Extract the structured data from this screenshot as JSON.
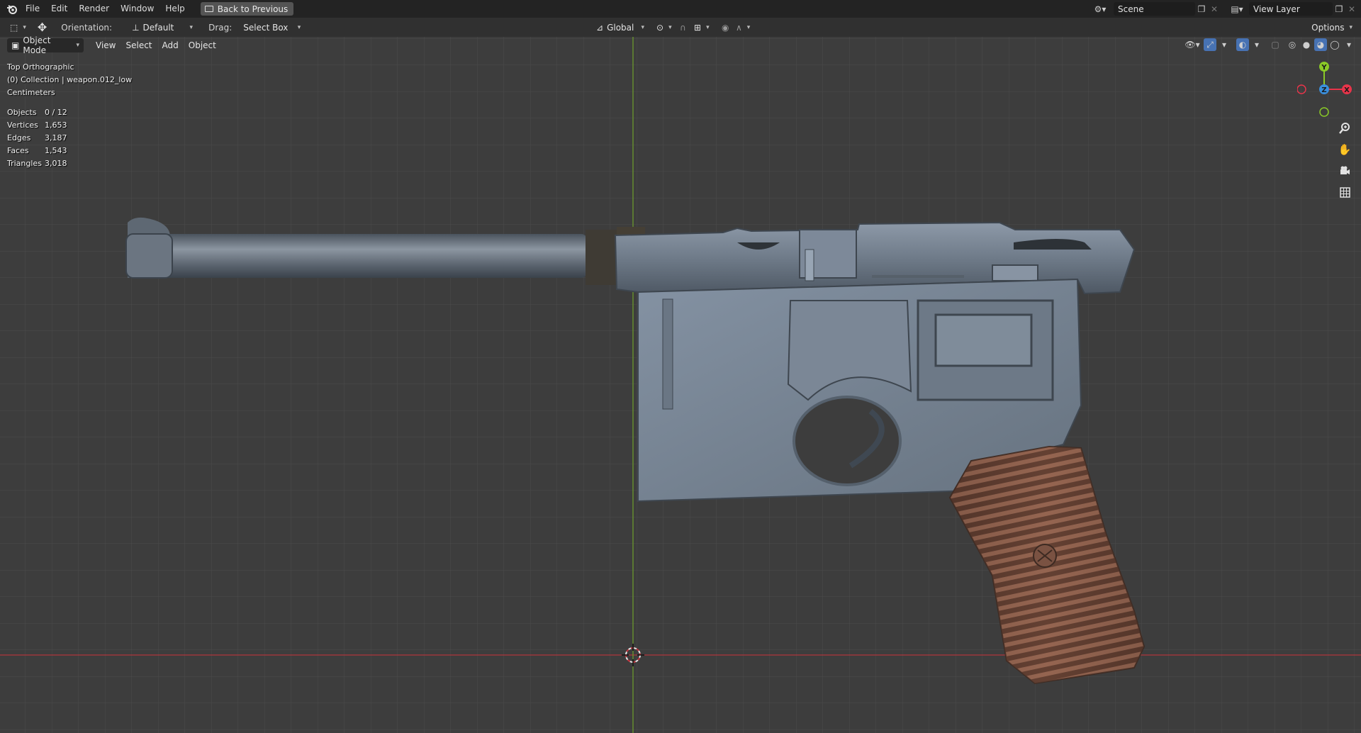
{
  "menubar": {
    "items": [
      "File",
      "Edit",
      "Render",
      "Window",
      "Help"
    ],
    "back_button": "Back to Previous",
    "scene": "Scene",
    "view_layer": "View Layer"
  },
  "toolheader": {
    "orientation_label": "Orientation:",
    "orientation_value": "Default",
    "drag_label": "Drag:",
    "drag_value": "Select Box",
    "transform_space": "Global",
    "options_label": "Options"
  },
  "viewport_header": {
    "mode": "Object Mode",
    "menus": [
      "View",
      "Select",
      "Add",
      "Object"
    ]
  },
  "overlay": {
    "view_name": "Top Orthographic",
    "collection": "(0) Collection | weapon.012_low",
    "units": "Centimeters"
  },
  "stats": [
    {
      "label": "Objects",
      "value": "0 / 12"
    },
    {
      "label": "Vertices",
      "value": "1,653"
    },
    {
      "label": "Edges",
      "value": "3,187"
    },
    {
      "label": "Faces",
      "value": "1,543"
    },
    {
      "label": "Triangles",
      "value": "3,018"
    }
  ],
  "gizmo": {
    "x_label": "X",
    "y_label": "Y",
    "z_label": "Z",
    "colors": {
      "x": "#e8344a",
      "y": "#8ac927",
      "z": "#3a8fdc"
    }
  },
  "icons": {
    "zoom": "zoom-icon",
    "pan": "hand-icon",
    "camera": "camera-icon",
    "ortho": "grid-icon"
  },
  "colors": {
    "background": "#3d3d3d",
    "x_axis": "#b0363d",
    "y_axis": "#6f9f2c"
  }
}
